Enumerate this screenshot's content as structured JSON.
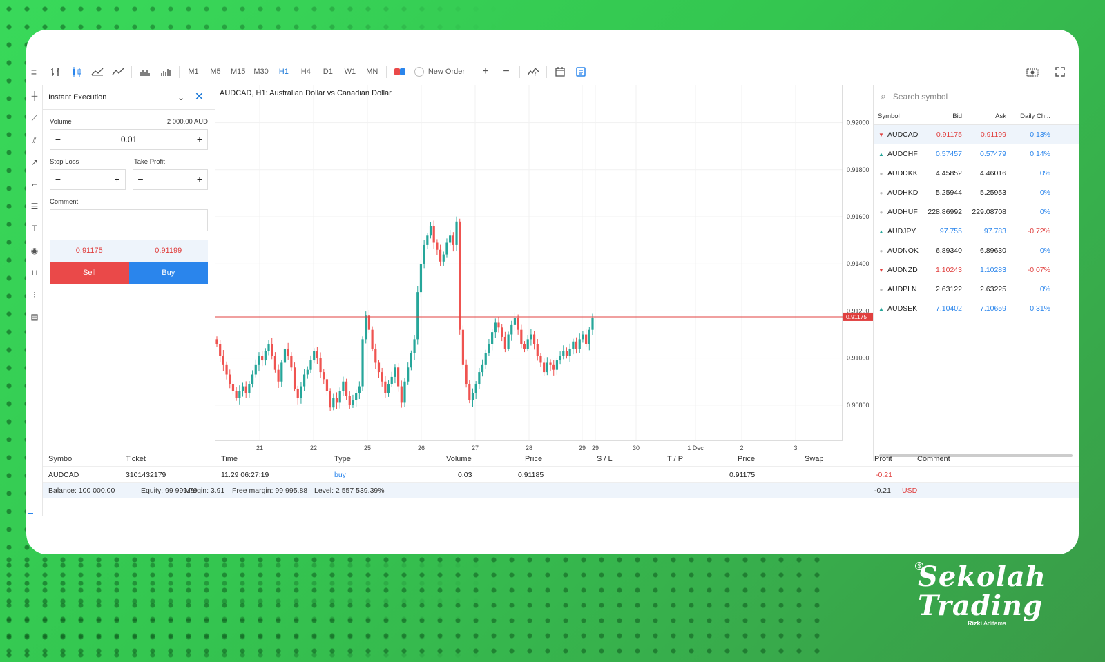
{
  "toolbar": {
    "timeframes": [
      "M1",
      "M5",
      "M15",
      "M30",
      "H1",
      "H4",
      "D1",
      "W1",
      "MN"
    ],
    "active_timeframe": "H1",
    "new_order_label": "New Order"
  },
  "order_panel": {
    "title": "Instant Execution",
    "volume_label": "Volume",
    "volume_amount": "2 000.00 AUD",
    "volume_value": "0.01",
    "stop_loss_label": "Stop Loss",
    "take_profit_label": "Take Profit",
    "comment_label": "Comment",
    "sell_price": "0.91175",
    "buy_price": "0.91199",
    "sell_label": "Sell",
    "buy_label": "Buy"
  },
  "chart": {
    "title": "AUDCAD, H1: Australian Dollar vs Canadian Dollar",
    "current_price_label": "0.91175"
  },
  "chart_data": {
    "type": "candlestick",
    "title": "AUDCAD, H1: Australian Dollar vs Canadian Dollar",
    "x_tick_labels": [
      "21",
      "22",
      "25",
      "26",
      "27",
      "28",
      "29",
      "29",
      "30",
      "1 Dec",
      "2",
      "3"
    ],
    "y_tick_labels": [
      "0.92000",
      "0.91800",
      "0.91600",
      "0.91400",
      "0.91200",
      "0.91000",
      "0.90800"
    ],
    "ylim": [
      0.9065,
      0.9216
    ],
    "current_price": 0.91175,
    "closes": [
      0.9106,
      0.9101,
      0.9097,
      0.9093,
      0.9089,
      0.9086,
      0.9083,
      0.9086,
      0.9088,
      0.9085,
      0.9089,
      0.9093,
      0.9097,
      0.9101,
      0.9099,
      0.9103,
      0.9106,
      0.9101,
      0.9095,
      0.909,
      0.9098,
      0.9104,
      0.9101,
      0.9096,
      0.9087,
      0.9083,
      0.9088,
      0.9093,
      0.9095,
      0.9099,
      0.9103,
      0.91,
      0.9094,
      0.9091,
      0.9086,
      0.9079,
      0.9083,
      0.9081,
      0.9086,
      0.909,
      0.9084,
      0.908,
      0.9082,
      0.9085,
      0.9088,
      0.9108,
      0.9118,
      0.9112,
      0.9104,
      0.9098,
      0.9094,
      0.909,
      0.9085,
      0.9089,
      0.9092,
      0.9096,
      0.9088,
      0.9081,
      0.909,
      0.9096,
      0.9102,
      0.9108,
      0.9128,
      0.914,
      0.9148,
      0.9152,
      0.9156,
      0.9149,
      0.9146,
      0.9141,
      0.9144,
      0.9149,
      0.9152,
      0.9148,
      0.9158,
      0.9112,
      0.9097,
      0.9089,
      0.9082,
      0.9085,
      0.9089,
      0.9094,
      0.9097,
      0.9102,
      0.9106,
      0.9111,
      0.9115,
      0.9113,
      0.9109,
      0.9104,
      0.911,
      0.9114,
      0.9117,
      0.9112,
      0.9106,
      0.9104,
      0.9108,
      0.911,
      0.9106,
      0.9101,
      0.9098,
      0.9094,
      0.9098,
      0.9097,
      0.9095,
      0.9099,
      0.9101,
      0.9103,
      0.9101,
      0.9104,
      0.9107,
      0.9104,
      0.9108,
      0.911,
      0.9106,
      0.9112,
      0.9117
    ],
    "x_label": "",
    "y_label": ""
  },
  "market_watch": {
    "search_placeholder": "Search symbol",
    "headers": [
      "Symbol",
      "Bid",
      "Ask",
      "Daily Ch..."
    ],
    "rows": [
      {
        "symbol": "AUDCAD",
        "bid": "0.91175",
        "ask": "0.91199",
        "change": "0.13%",
        "dir": "dn",
        "bidc": "red",
        "askc": "red",
        "chgc": "blue"
      },
      {
        "symbol": "AUDCHF",
        "bid": "0.57457",
        "ask": "0.57479",
        "change": "0.14%",
        "dir": "up",
        "bidc": "blue",
        "askc": "blue",
        "chgc": "blue"
      },
      {
        "symbol": "AUDDKK",
        "bid": "4.45852",
        "ask": "4.46016",
        "change": "0%",
        "dir": "nt",
        "bidc": "black",
        "askc": "black",
        "chgc": "blue"
      },
      {
        "symbol": "AUDHKD",
        "bid": "5.25944",
        "ask": "5.25953",
        "change": "0%",
        "dir": "nt",
        "bidc": "black",
        "askc": "black",
        "chgc": "blue"
      },
      {
        "symbol": "AUDHUF",
        "bid": "228.86992",
        "ask": "229.08708",
        "change": "0%",
        "dir": "nt",
        "bidc": "black",
        "askc": "black",
        "chgc": "blue"
      },
      {
        "symbol": "AUDJPY",
        "bid": "97.755",
        "ask": "97.783",
        "change": "-0.72%",
        "dir": "up",
        "bidc": "blue",
        "askc": "blue",
        "chgc": "red"
      },
      {
        "symbol": "AUDNOK",
        "bid": "6.89340",
        "ask": "6.89630",
        "change": "0%",
        "dir": "nt",
        "bidc": "black",
        "askc": "black",
        "chgc": "blue"
      },
      {
        "symbol": "AUDNZD",
        "bid": "1.10243",
        "ask": "1.10283",
        "change": "-0.07%",
        "dir": "dn",
        "bidc": "red",
        "askc": "blue",
        "chgc": "red"
      },
      {
        "symbol": "AUDPLN",
        "bid": "2.63122",
        "ask": "2.63225",
        "change": "0%",
        "dir": "nt",
        "bidc": "black",
        "askc": "black",
        "chgc": "blue"
      },
      {
        "symbol": "AUDSEK",
        "bid": "7.10402",
        "ask": "7.10659",
        "change": "0.31%",
        "dir": "up",
        "bidc": "blue",
        "askc": "blue",
        "chgc": "blue"
      }
    ]
  },
  "trades": {
    "headers": {
      "symbol": "Symbol",
      "ticket": "Ticket",
      "time": "Time",
      "type": "Type",
      "volume": "Volume",
      "price": "Price",
      "sl": "S / L",
      "tp": "T / P",
      "price2": "Price",
      "swap": "Swap",
      "profit": "Profit",
      "comment": "Comment"
    },
    "row": {
      "symbol": "AUDCAD",
      "ticket": "3101432179",
      "time": "11.29 06:27:19",
      "type": "buy",
      "volume": "0.03",
      "price": "0.91185",
      "price2": "0.91175",
      "profit": "-0.21"
    },
    "summary": {
      "balance": "Balance: 100 000.00",
      "equity": "Equity: 99 999.79",
      "margin": "Margin: 3.91",
      "free_margin": "Free margin: 99 995.88",
      "level": "Level: 2 557 539.39%",
      "total": "-0.21",
      "currency": "USD"
    }
  },
  "logo": {
    "line1": "Sekolah",
    "line2": "Trading",
    "byline_bold": "Rizki",
    "byline": "Aditama"
  },
  "colors": {
    "up": "#26a69a",
    "down": "#ef5350",
    "accent": "#2a85ec",
    "background": "#39d95a"
  }
}
